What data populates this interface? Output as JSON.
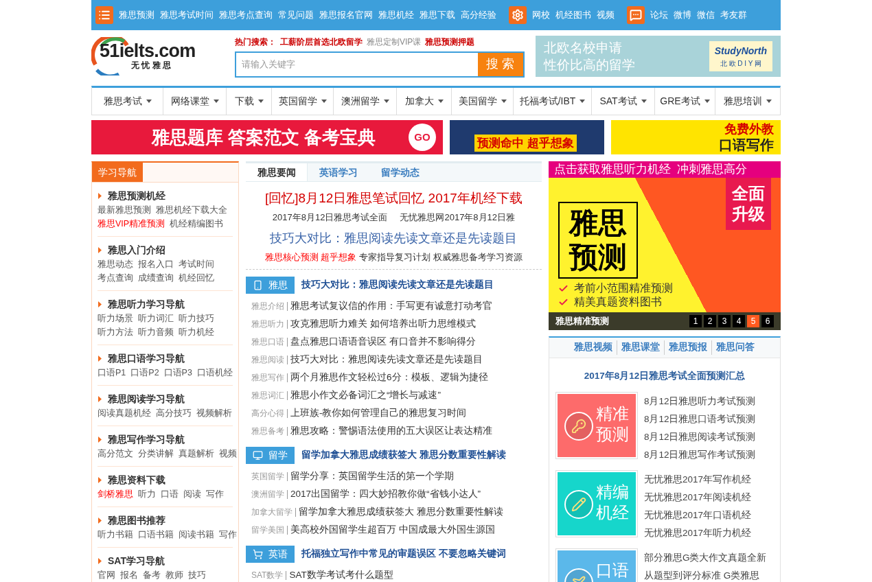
{
  "top_bar": [
    {
      "kind": "list",
      "links": [
        "雅思预测",
        "雅思考试时间",
        "雅思考点查询",
        "常见问题",
        "雅思报名官网",
        "雅思机经",
        "雅思下载",
        "高分经验"
      ]
    },
    {
      "kind": "gear",
      "links": [
        "网校",
        "机经图书",
        "视频"
      ]
    },
    {
      "kind": "chat",
      "links": [
        "论坛",
        "微博",
        "微信",
        "考友群"
      ]
    }
  ],
  "header": {
    "logo": {
      "text": "51ielts.com",
      "subtitle": "无 忧 雅 思"
    },
    "hot_search": {
      "label": "热门搜索：",
      "items": [
        {
          "text": "工薪阶层首选北欧留学",
          "highlight": true
        },
        {
          "text": "雅思定制VIP课",
          "highlight": false
        },
        {
          "text": "雅思预测押题",
          "highlight": true
        }
      ]
    },
    "search": {
      "placeholder": "请输入关键字",
      "button": "搜 索"
    },
    "ad": {
      "lines": [
        "北欧名校申请",
        "性价比高的留学"
      ],
      "brand": "StudyNorth",
      "brand_sub": "北 欧 D I Y 网"
    }
  },
  "nav": [
    "雅思考试",
    "网络课堂",
    "下载",
    "英国留学",
    "澳洲留学",
    "加拿大",
    "美国留学",
    "托福考试/IBT",
    "SAT考试",
    "GRE考试",
    "雅思培训"
  ],
  "banners": [
    {
      "kind": "red",
      "text": "雅思题库 答案范文 备考宝典",
      "button": "GO"
    },
    {
      "kind": "navy",
      "text": "预测命中 超乎想象"
    },
    {
      "kind": "yellow",
      "lines": [
        "免费外教",
        "口语写作"
      ]
    }
  ],
  "left": {
    "title": "学习导航",
    "sections": [
      {
        "title": "雅思预测机经",
        "rows": [
          [
            {
              "text": "最新雅思预测",
              "highlight": false
            },
            {
              "text": "雅思机经下载大全",
              "highlight": false
            }
          ],
          [
            {
              "text": "雅思VIP精准预测",
              "highlight": true
            },
            {
              "text": "机经精编图书",
              "highlight": false
            }
          ]
        ]
      },
      {
        "title": "雅思入门介绍",
        "rows": [
          [
            {
              "text": "雅思动态",
              "highlight": false
            },
            {
              "text": "报名入口",
              "highlight": false
            },
            {
              "text": "考试时间",
              "highlight": false
            }
          ],
          [
            {
              "text": "考点查询",
              "highlight": false
            },
            {
              "text": "成绩查询",
              "highlight": false
            },
            {
              "text": "机经回忆",
              "highlight": false
            }
          ]
        ]
      },
      {
        "title": "雅思听力学习导航",
        "rows": [
          [
            {
              "text": "听力场景",
              "highlight": false
            },
            {
              "text": "听力词汇",
              "highlight": false
            },
            {
              "text": "听力技巧",
              "highlight": false
            }
          ],
          [
            {
              "text": "听力方法",
              "highlight": false
            },
            {
              "text": "听力音频",
              "highlight": false
            },
            {
              "text": "听力机经",
              "highlight": false
            }
          ]
        ]
      },
      {
        "title": "雅思口语学习导航",
        "rows": [
          [
            {
              "text": "口语P1",
              "highlight": false
            },
            {
              "text": "口语P2",
              "highlight": false
            },
            {
              "text": "口语P3",
              "highlight": false
            },
            {
              "text": "口语机经",
              "highlight": false
            }
          ]
        ]
      },
      {
        "title": "雅思阅读学习导航",
        "rows": [
          [
            {
              "text": "阅读真题机经",
              "highlight": false
            },
            {
              "text": "高分技巧",
              "highlight": false
            },
            {
              "text": "视频解析",
              "highlight": false
            }
          ]
        ]
      },
      {
        "title": "雅思写作学习导航",
        "rows": [
          [
            {
              "text": "高分范文",
              "highlight": false
            },
            {
              "text": "分类讲解",
              "highlight": false
            },
            {
              "text": "真题解析",
              "highlight": false
            },
            {
              "text": "视频",
              "highlight": false
            }
          ]
        ]
      },
      {
        "title": "雅思资料下载",
        "rows": [
          [
            {
              "text": "剑桥雅思",
              "highlight": true
            },
            {
              "text": "听力",
              "highlight": false
            },
            {
              "text": "口语",
              "highlight": false
            },
            {
              "text": "阅读",
              "highlight": false
            },
            {
              "text": "写作",
              "highlight": false
            }
          ]
        ]
      },
      {
        "title": "雅思图书推荐",
        "rows": [
          [
            {
              "text": "听力书籍",
              "highlight": false
            },
            {
              "text": "口语书籍",
              "highlight": false
            },
            {
              "text": "阅读书籍",
              "highlight": false
            },
            {
              "text": "写作",
              "highlight": false
            }
          ]
        ]
      },
      {
        "title": "SAT学习导航",
        "rows": [
          [
            {
              "text": "官网",
              "highlight": false
            },
            {
              "text": "报名",
              "highlight": false
            },
            {
              "text": "备考",
              "highlight": false
            },
            {
              "text": "教师",
              "highlight": false
            },
            {
              "text": "技巧",
              "highlight": false
            }
          ]
        ]
      }
    ]
  },
  "middle": {
    "tabs": [
      {
        "label": "雅思要闻",
        "selected": true
      },
      {
        "label": "英语学习",
        "selected": false
      },
      {
        "label": "留学动态",
        "selected": false
      }
    ],
    "headline": "[回忆]8月12日雅思笔试回忆 2017年机经下载",
    "summary": [
      "2017年8月12日雅思考试全面",
      "无忧雅思网2017年8月12日雅"
    ],
    "subheadline": "技巧大对比：雅思阅读先读文章还是先读题目",
    "promo": [
      {
        "text": "雅思核心预测 超乎想象",
        "highlight": true
      },
      {
        "text": "专家指导复习计划 权威雅思备考学习资源",
        "highlight": false
      }
    ],
    "categories": [
      {
        "kind": "phone",
        "tag": "雅思",
        "headline": "技巧大对比：雅思阅读先读文章还是先读题目",
        "items": [
          {
            "category": "雅思介绍",
            "title": "雅思考试复议信的作用：手写更有诚意打动考官"
          },
          {
            "category": "雅思听力",
            "title": "攻克雅思听力难关 如何培养出听力思维模式"
          },
          {
            "category": "雅思口语",
            "title": "盘点雅思口语语音误区 有口音并不影响得分"
          },
          {
            "category": "雅思阅读",
            "title": "技巧大对比：雅思阅读先读文章还是先读题目"
          },
          {
            "category": "雅思写作",
            "title": "两个月雅思作文轻松过6分：模板、逻辑为捷径"
          },
          {
            "category": "雅思词汇",
            "title": "雅思小作文必备词汇之“增长与减速”"
          },
          {
            "category": "高分心得",
            "title": "上班族-教你如何管理自己的雅思复习时间"
          },
          {
            "category": "雅思备考",
            "title": "雅思攻略：警惕语法使用的五大误区让表达精准"
          }
        ]
      },
      {
        "kind": "monitor",
        "tag": "留学",
        "headline": "留学加拿大雅思成绩获签大 雅思分数重要性解读",
        "items": [
          {
            "category": "英国留学",
            "title": "留学分享：英国留学生活的第一个学期"
          },
          {
            "category": "澳洲留学",
            "title": "2017出国留学：四大妙招教你做“省钱小达人”"
          },
          {
            "category": "加拿大留学",
            "title": "留学加拿大雅思成绩获签大 雅思分数重要性解读"
          },
          {
            "category": "留学美国",
            "title": "美高校外国留学生超百万 中国成最大外国生源国"
          }
        ]
      },
      {
        "kind": "cart",
        "tag": "英语",
        "headline": "托福独立写作中常见的审题误区 不要忽略关键词",
        "items": [
          {
            "category": "SAT数学",
            "title": "SAT数学考试考什么题型"
          }
        ]
      }
    ]
  },
  "right": {
    "carousel": {
      "top_text": "点击获取雅思听力机经  冲刺雅思高分",
      "badge": [
        "全面",
        "升级"
      ],
      "big": [
        "雅思",
        "预测"
      ],
      "bullets": [
        "考前小范围精准预测",
        "精美真题资料图书"
      ],
      "caption": "雅思精准预测",
      "pages": [
        {
          "label": "1",
          "selected": false
        },
        {
          "label": "2",
          "selected": false
        },
        {
          "label": "3",
          "selected": false
        },
        {
          "label": "4",
          "selected": false
        },
        {
          "label": "5",
          "selected": true
        },
        {
          "label": "6",
          "selected": false
        }
      ]
    },
    "box": {
      "tabs": [
        "雅思视频",
        "雅思课堂",
        "雅思预报",
        "雅思问答"
      ],
      "title": "2017年8月12日雅思考试全面预测汇总",
      "cards": [
        {
          "kind": "key",
          "label": [
            "精准",
            "预测"
          ],
          "items": [
            "8月12日雅思听力考试预测",
            "8月12日雅思口语考试预测",
            "8月12日雅思阅读考试预测",
            "8月12日雅思写作考试预测"
          ]
        },
        {
          "kind": "pencil",
          "label": [
            "精编",
            "机经"
          ],
          "items": [
            "无忧雅思2017年写作机经",
            "无忧雅思2017年阅读机经",
            "无忧雅思2017年口语机经",
            "无忧雅思2017年听力机经"
          ]
        },
        {
          "kind": "plane",
          "label": [
            "口语"
          ],
          "items": [
            "部分雅思G类大作文真题全新",
            "从题型到评分标准 G类雅思"
          ]
        }
      ]
    }
  }
}
